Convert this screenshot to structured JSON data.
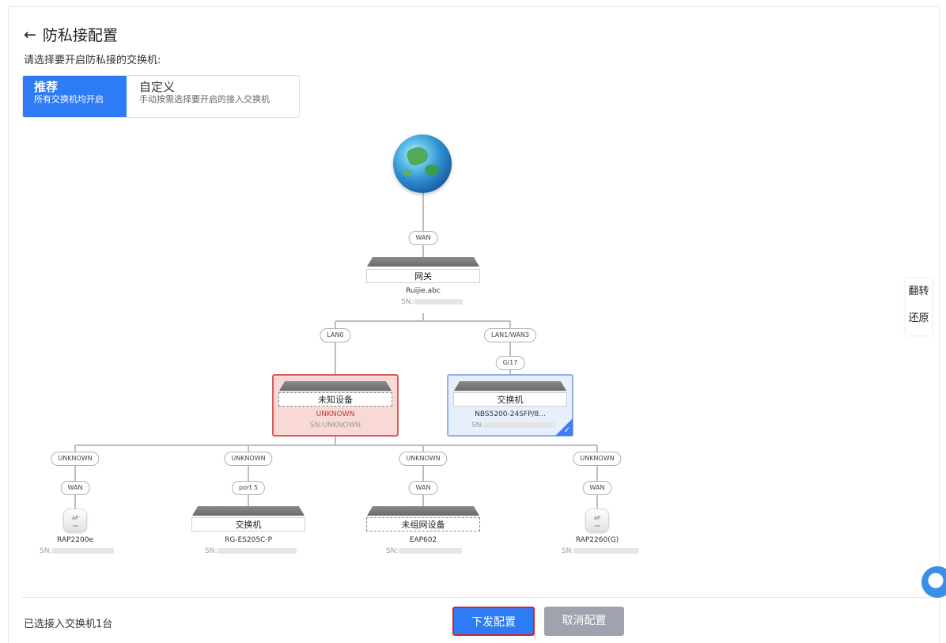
{
  "page": {
    "title": "防私接配置",
    "prompt": "请选择要开启防私接的交换机:"
  },
  "modes": [
    {
      "label": "推荐",
      "desc": "所有交换机均开启"
    },
    {
      "label": "自定义",
      "desc": "手动按需选择要开启的接入交换机"
    }
  ],
  "side_ops": {
    "flip": "翻转",
    "restore": "还原"
  },
  "topology": {
    "wan_port": "WAN",
    "gateway": {
      "name": "网关",
      "model": "Ruijie.abc",
      "sn": "SN:"
    },
    "gw_ports": {
      "left": "LAN0",
      "right": "LAN1/WAN3"
    },
    "switch_port": "Gi17",
    "unknown_device": {
      "name": "未知设备",
      "model": "UNKNOWN",
      "sn": "SN:UNKNOWN"
    },
    "core_switch": {
      "name": "交换机",
      "model": "NBS5200-24SFP/8...",
      "sn": "SN:"
    },
    "children": [
      {
        "up": "UNKNOWN",
        "down": "WAN",
        "type": "ap",
        "icon_label": "AP",
        "name": "",
        "model": "RAP2200e",
        "sn": "SN:"
      },
      {
        "up": "UNKNOWN",
        "down": "port 5",
        "type": "switch",
        "name": "交换机",
        "model": "RG-ES205C-P",
        "sn": "SN:"
      },
      {
        "up": "UNKNOWN",
        "down": "WAN",
        "type": "switch",
        "name": "未组网设备",
        "model": "EAP602",
        "sn": "SN:"
      },
      {
        "up": "UNKNOWN",
        "down": "WAN",
        "type": "ap",
        "icon_label": "AP",
        "name": "",
        "model": "RAP2260(G)",
        "sn": "SN:"
      }
    ]
  },
  "footer": {
    "selected_text": "已选接入交换机1台",
    "confirm": "下发配置",
    "cancel": "取消配置"
  },
  "colors": {
    "accent": "#2e7bf6",
    "unknown_border": "#e05a5a",
    "selected_border": "#8db0ef",
    "cancel_bg": "#9ea3ad"
  }
}
